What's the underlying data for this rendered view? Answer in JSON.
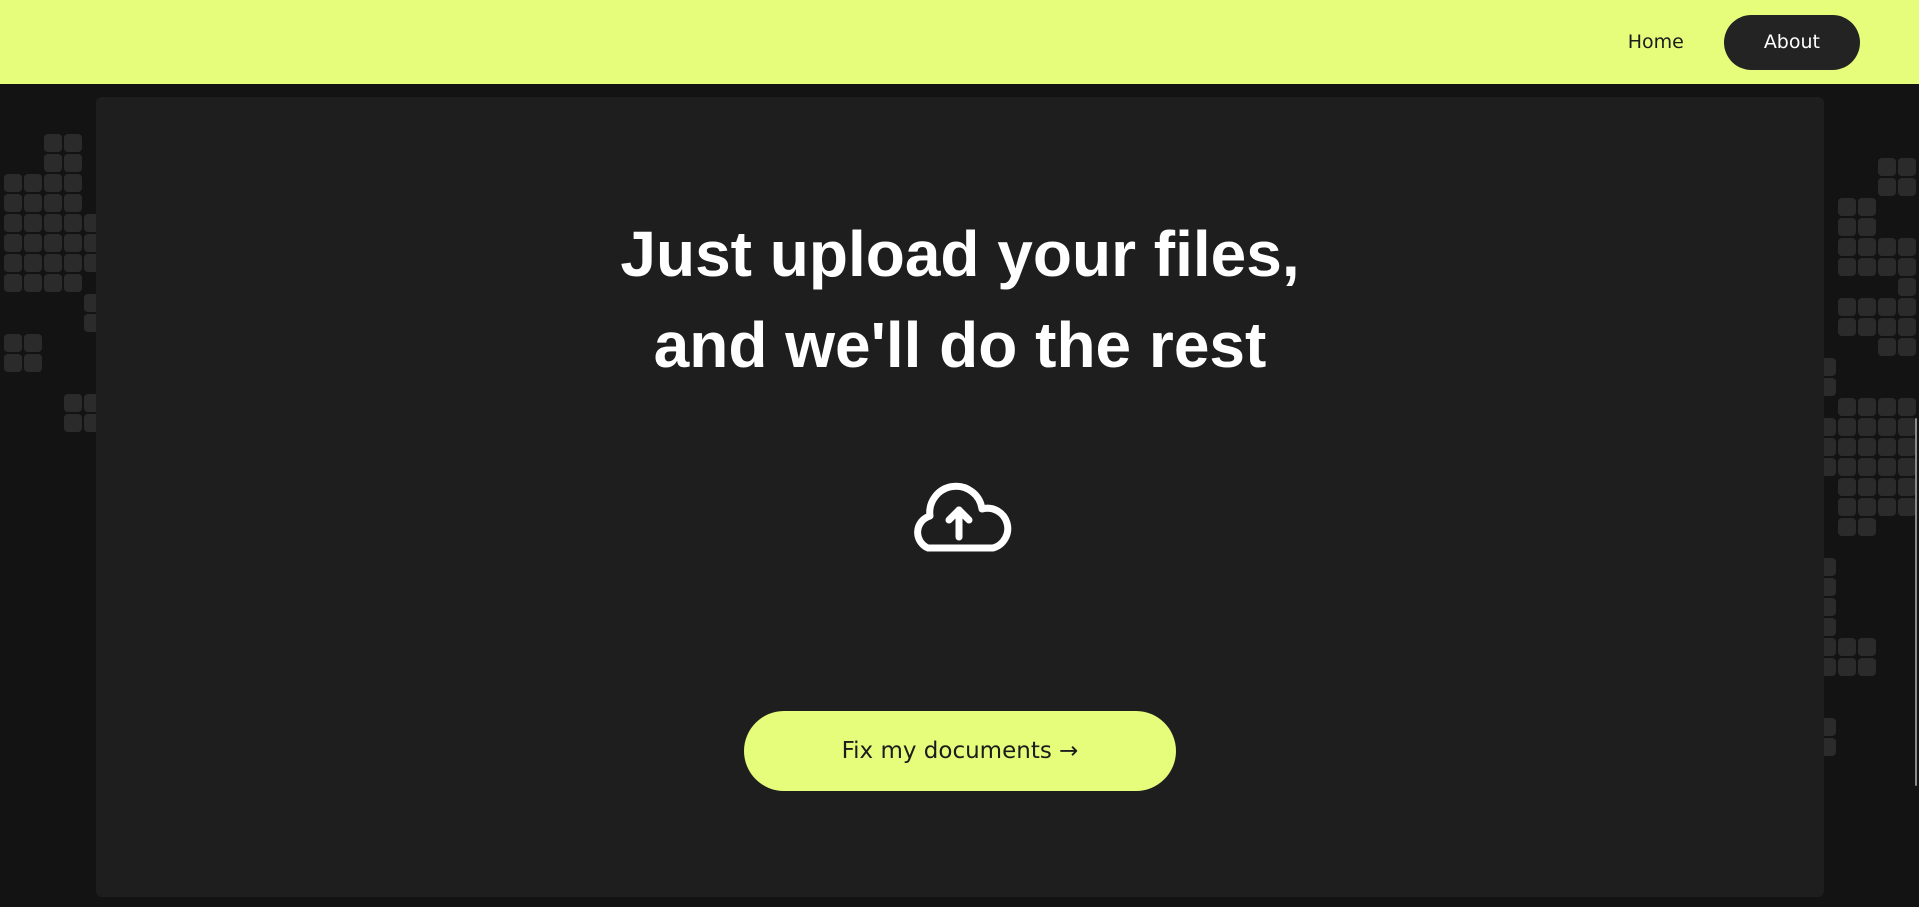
{
  "nav": {
    "home_label": "Home",
    "about_label": "About"
  },
  "hero": {
    "headline_line1": "Just upload your files,",
    "headline_line2": "and we'll do the rest",
    "upload_icon": "cloud-upload-icon",
    "cta_label": "Fix my documents →"
  },
  "colors": {
    "accent": "#e5fd7b",
    "page_background": "#131313",
    "panel_background": "#1e1e1e",
    "active_nav_background": "#232323",
    "grid_tile": "#2b2b2b",
    "text_light": "#ffffff",
    "text_dark": "#1c1c1c"
  }
}
